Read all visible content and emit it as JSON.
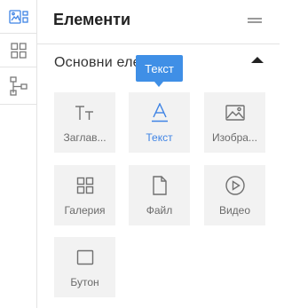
{
  "rail": {
    "items": [
      {
        "icon": "layout-elements-icon",
        "active": true
      },
      {
        "icon": "grid-icon",
        "active": false
      },
      {
        "icon": "sitemap-icon",
        "active": false
      }
    ]
  },
  "panel": {
    "title": "Елементи",
    "menu_icon": "hamburger-icon"
  },
  "section": {
    "title": "Основни елементи",
    "collapse_icon": "caret-up-icon"
  },
  "tooltip": {
    "text": "Текст"
  },
  "elements": [
    {
      "label": "Заглав...",
      "icon": "heading-icon"
    },
    {
      "label": "Текст",
      "icon": "text-icon",
      "active": true
    },
    {
      "label": "Изобра...",
      "icon": "image-icon"
    },
    {
      "label": "Галерия",
      "icon": "gallery-icon"
    },
    {
      "label": "Файл",
      "icon": "file-icon"
    },
    {
      "label": "Видео",
      "icon": "video-icon"
    },
    {
      "label": "Бутон",
      "icon": "button-icon"
    }
  ],
  "colors": {
    "accent": "#3f84e5",
    "tile_background": "#f2f2f2",
    "tooltip_background": "#3f8fe6"
  }
}
